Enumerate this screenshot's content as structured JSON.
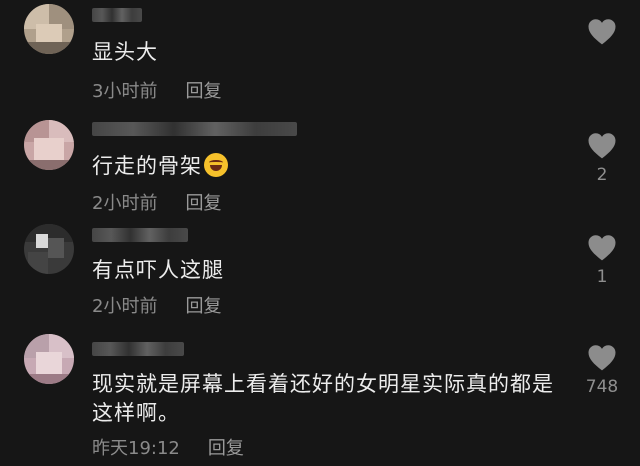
{
  "comments": [
    {
      "text": "显头大",
      "time": "3小时前",
      "reply_label": "回复",
      "like_count": "",
      "avatar_colors": [
        "#b0a08c",
        "#d8c8b6",
        "#6f6356"
      ]
    },
    {
      "text": "行走的骨架",
      "emoji": "laughing-with-tears",
      "time": "2小时前",
      "reply_label": "回复",
      "like_count": "2",
      "avatar_colors": [
        "#c9a6a6",
        "#e8d0cc",
        "#8a6e6e"
      ]
    },
    {
      "text": "有点吓人这腿",
      "time": "2小时前",
      "reply_label": "回复",
      "like_count": "1",
      "avatar_colors": [
        "#2c2c2c",
        "#d9d9d9",
        "#555555"
      ]
    },
    {
      "text": "现实就是屏幕上看着还好的女明星实际真的都是这样啊。",
      "time": "昨天19:12",
      "reply_label": "回复",
      "like_count": "748",
      "avatar_colors": [
        "#c7a9b4",
        "#e9d6d9",
        "#9c7b86"
      ]
    }
  ],
  "colors": {
    "background": "#161616",
    "text": "#ececec",
    "meta": "#8a8a8a",
    "heart": "#8c8c8c"
  },
  "icons": {
    "like": "heart-icon",
    "emoji": "laughing-emoji-icon"
  }
}
